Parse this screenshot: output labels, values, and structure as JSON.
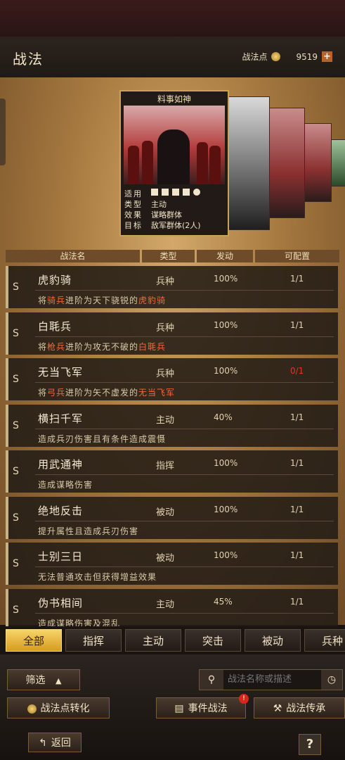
{
  "header": {
    "title": "战法",
    "points_label": "战法点",
    "points_value": "9519",
    "add": "+"
  },
  "featured": {
    "name": "料事如神",
    "labels": {
      "apply": "适用",
      "type": "类型",
      "effect": "效果",
      "target": "目标"
    },
    "type": "主动",
    "effect": "谋略群体",
    "target": "敌军群体(2人)"
  },
  "table": {
    "headers": {
      "name": "战法名",
      "type": "类型",
      "rate": "发动",
      "slot": "可配置"
    },
    "rows": [
      {
        "grade": "S",
        "name": "虎豹骑",
        "type": "兵种",
        "rate": "100%",
        "slot": "1/1",
        "d1": "将",
        "d2": "骑兵",
        "d3": "进阶为天下骁锐的",
        "d4": "虎豹骑"
      },
      {
        "grade": "S",
        "name": "白毦兵",
        "type": "兵种",
        "rate": "100%",
        "slot": "1/1",
        "d1": "将",
        "d2": "枪兵",
        "d3": "进阶为攻无不破的",
        "d4": "白毦兵"
      },
      {
        "grade": "S",
        "name": "无当飞军",
        "type": "兵种",
        "rate": "100%",
        "slot": "0/1",
        "d1": "将",
        "d2": "弓兵",
        "d3": "进阶为矢不虚发的",
        "d4": "无当飞军"
      },
      {
        "grade": "S",
        "name": "横扫千军",
        "type": "主动",
        "rate": "40%",
        "slot": "1/1",
        "desc": "造成兵刃伤害且有条件造成震慑"
      },
      {
        "grade": "S",
        "name": "用武通神",
        "type": "指挥",
        "rate": "100%",
        "slot": "1/1",
        "desc": "造成谋略伤害"
      },
      {
        "grade": "S",
        "name": "绝地反击",
        "type": "被动",
        "rate": "100%",
        "slot": "1/1",
        "desc": "提升属性且造成兵刃伤害"
      },
      {
        "grade": "S",
        "name": "士别三日",
        "type": "被动",
        "rate": "100%",
        "slot": "1/1",
        "desc": "无法普通攻击但获得增益效果"
      },
      {
        "grade": "S",
        "name": "伪书相间",
        "type": "主动",
        "rate": "45%",
        "slot": "1/1",
        "desc": "造成谋略伤害及混乱"
      }
    ]
  },
  "tabs": [
    "全部",
    "指挥",
    "主动",
    "突击",
    "被动",
    "兵种"
  ],
  "controls": {
    "filter": "筛选",
    "search_placeholder": "战法名称或描述",
    "convert": "战法点转化",
    "event": "事件战法",
    "event_badge": "!",
    "inherit": "战法传承",
    "back": "返回",
    "help": "?"
  }
}
